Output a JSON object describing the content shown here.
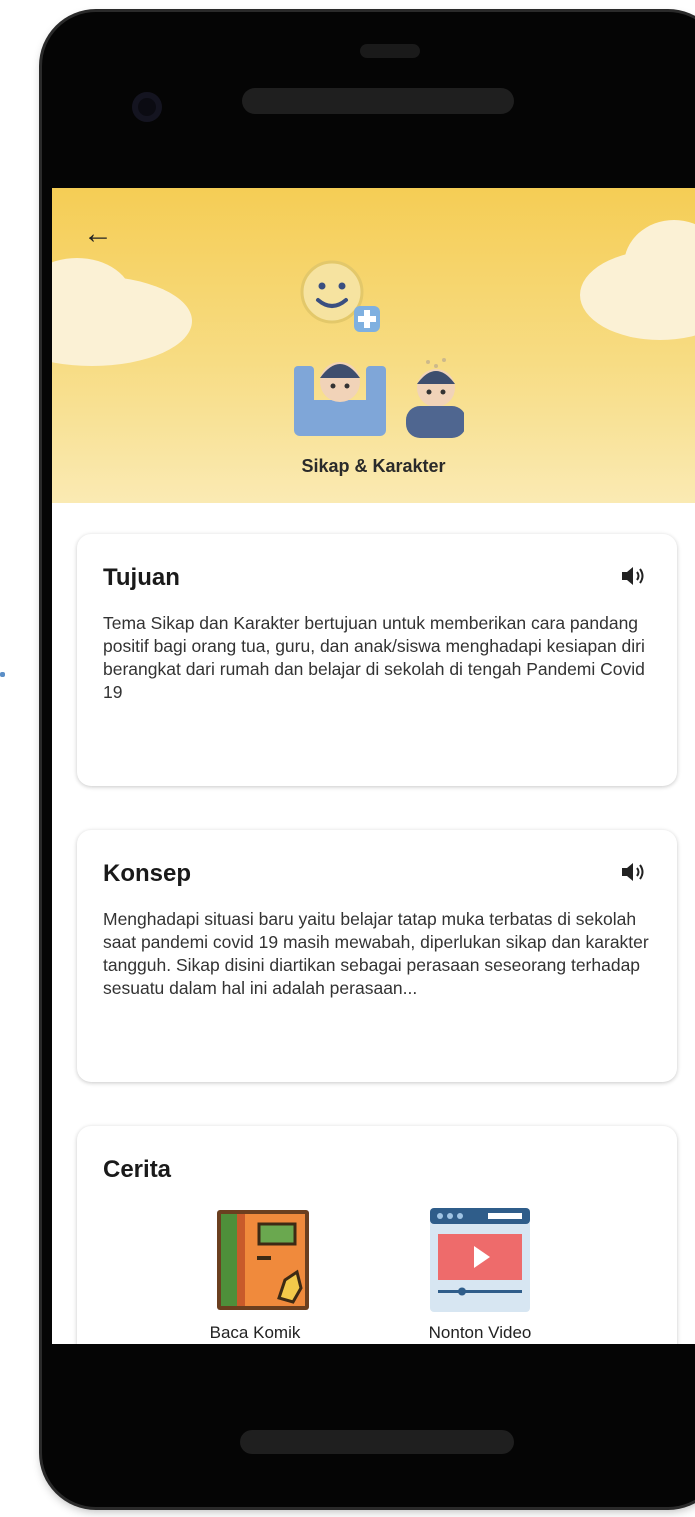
{
  "header": {
    "title": "Sikap & Karakter",
    "back_icon": "arrow-left-icon",
    "accent": "#f5cd55"
  },
  "cards": {
    "tujuan": {
      "title": "Tujuan",
      "icon": "speaker-icon",
      "body": "Tema Sikap dan Karakter bertujuan untuk memberikan cara pandang positif bagi orang tua, guru, dan anak/siswa menghadapi kesiapan diri berangkat dari rumah dan belajar di sekolah di tengah Pandemi Covid 19"
    },
    "konsep": {
      "title": "Konsep",
      "icon": "speaker-icon",
      "body": "Menghadapi situasi baru yaitu belajar tatap muka terbatas di sekolah saat pandemi covid 19 masih mewabah, diperlukan sikap dan karakter tangguh. Sikap disini diartikan sebagai perasaan seseorang terhadap sesuatu dalam hal ini adalah perasaan..."
    },
    "cerita": {
      "title": "Cerita",
      "items": [
        {
          "label": "Baca Komik",
          "icon": "comic-book-icon"
        },
        {
          "label": "Nonton Video",
          "icon": "video-player-icon"
        }
      ]
    }
  }
}
